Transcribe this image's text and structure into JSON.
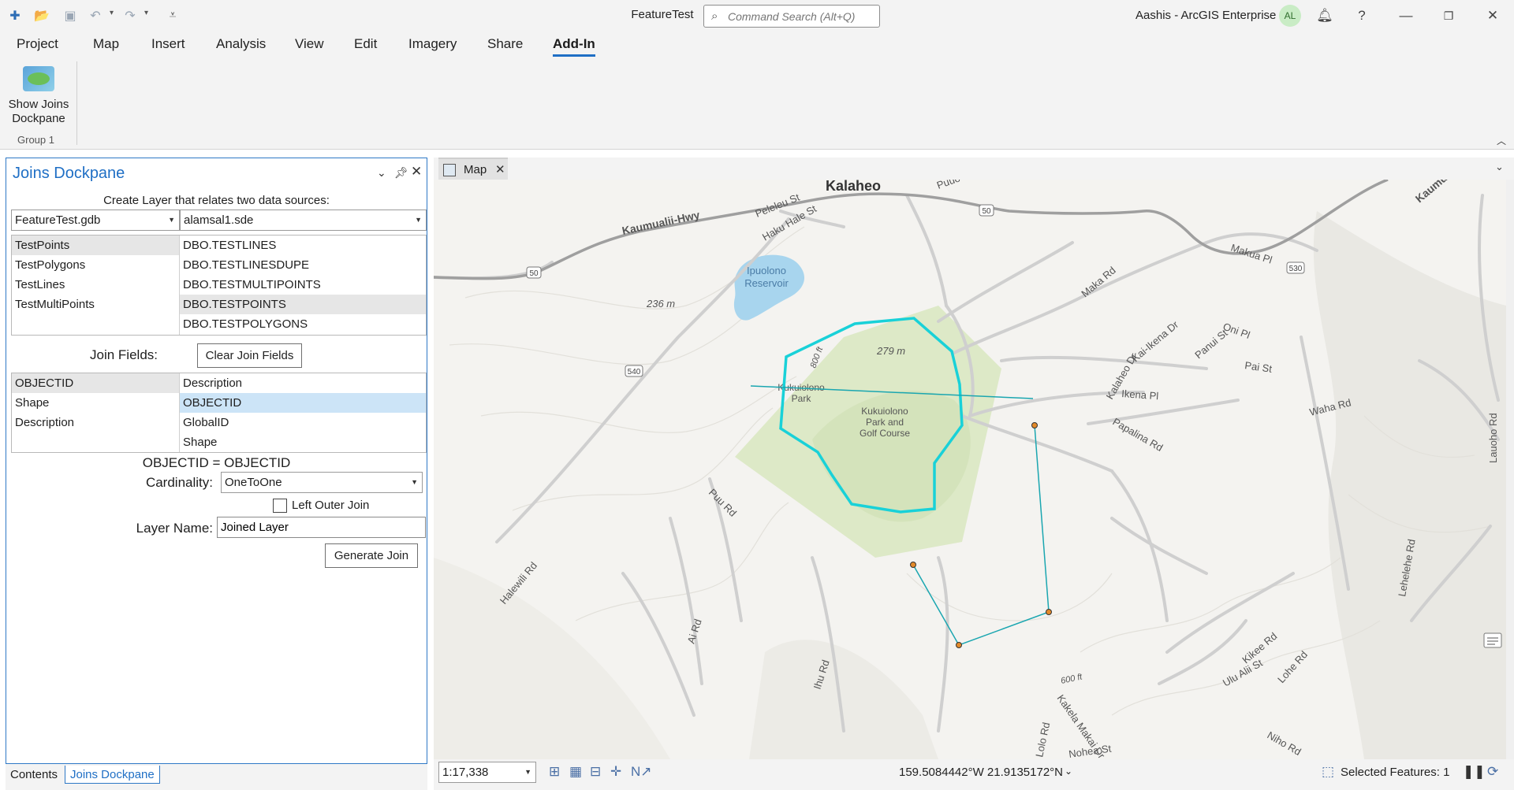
{
  "titlebar": {
    "app_title": "FeatureTest",
    "search_placeholder": "Command Search (Alt+Q)",
    "user": "Aashis - ArcGIS Enterprise",
    "avatar_initials": "AL",
    "help": "?"
  },
  "ribbon": {
    "tabs": [
      "Project",
      "Map",
      "Insert",
      "Analysis",
      "View",
      "Edit",
      "Imagery",
      "Share",
      "Add-In"
    ],
    "active_tab": "Add-In",
    "button_label_line1": "Show Joins",
    "button_label_line2": "Dockpane",
    "group_label": "Group 1"
  },
  "dockpane": {
    "title": "Joins Dockpane",
    "caption": "Create Layer that relates two data sources:",
    "left_source": "FeatureTest.gdb",
    "right_source": "alamsal1.sde",
    "left_layers": [
      "TestPoints",
      "TestPolygons",
      "TestLines",
      "TestMultiPoints"
    ],
    "right_tables": [
      "DBO.TESTLINES",
      "DBO.TESTLINESDUPE",
      "DBO.TESTMULTIPOINTS",
      "DBO.TESTPOINTS",
      "DBO.TESTPOLYGONS"
    ],
    "join_fields_label": "Join Fields:",
    "clear_button": "Clear Join Fields",
    "left_fields": [
      "OBJECTID",
      "Shape",
      "Description"
    ],
    "right_fields": [
      "Description",
      "OBJECTID",
      "GlobalID",
      "Shape"
    ],
    "join_expression": "OBJECTID = OBJECTID",
    "cardinality_label": "Cardinality:",
    "cardinality_value": "OneToOne",
    "left_outer_join_label": "Left Outer Join",
    "layer_name_label": "Layer Name:",
    "layer_name_value": "Joined Layer",
    "generate_button": "Generate Join"
  },
  "bottom_tabs": [
    "Contents",
    "Joins Dockpane"
  ],
  "map": {
    "tab_label": "Map",
    "labels": {
      "kalaheo": "Kalaheo",
      "kaumualii_hwy": "Kaumualii-Hwy",
      "kaumualii_hwy_2": "Kaumualii-Hwy",
      "peleleu": "Peleleu St",
      "haku_hale": "Haku Hale St",
      "puuo": "Puuo",
      "makua": "Makua Pl",
      "maka": "Maka Rd",
      "ipuolono_1": "Ipuolono",
      "ipuolono_2": "Reservoir",
      "elev_236": "236 m",
      "elev_279": "279 m",
      "kai_ikena": "Kai-Ikena Dr",
      "panui": "Panui St",
      "oni": "Oni Pl",
      "pai": "Pai St",
      "kalaheo_dr": "Kalaheo Dr",
      "ikena": "Ikena Pl",
      "kukuiolono_park_1": "Kukuiolono",
      "kukuiolono_park_2": "Park",
      "golf_1": "Kukuiolono",
      "golf_2": "Park and",
      "golf_3": "Golf Course",
      "papalina": "Papalina Rd",
      "waha": "Waha Rd",
      "halewili": "Halewili Rd",
      "puu": "Puu Rd",
      "ai": "Ai Rd",
      "ihu": "Ihu Rd",
      "kakela": "Kakela Makai Dr",
      "lolo": "Lolo Rd",
      "nohea": "Nohea St",
      "uluali": "Ulu Alii St",
      "kikee": "Kikee Rd",
      "lohe": "Lohe Rd",
      "niho": "Niho Rd",
      "lehelehe": "Lehelehe Rd",
      "lauoho": "Lauoho Rd",
      "ft_600": "600 ft",
      "ft_800": "800 ft",
      "shield_50a": "50",
      "shield_50b": "50",
      "shield_540": "540",
      "shield_530": "530"
    }
  },
  "status": {
    "scale": "1:17,338",
    "coordinates": "159.5084442°W 21.9135172°N",
    "selected": "Selected Features: 1"
  }
}
